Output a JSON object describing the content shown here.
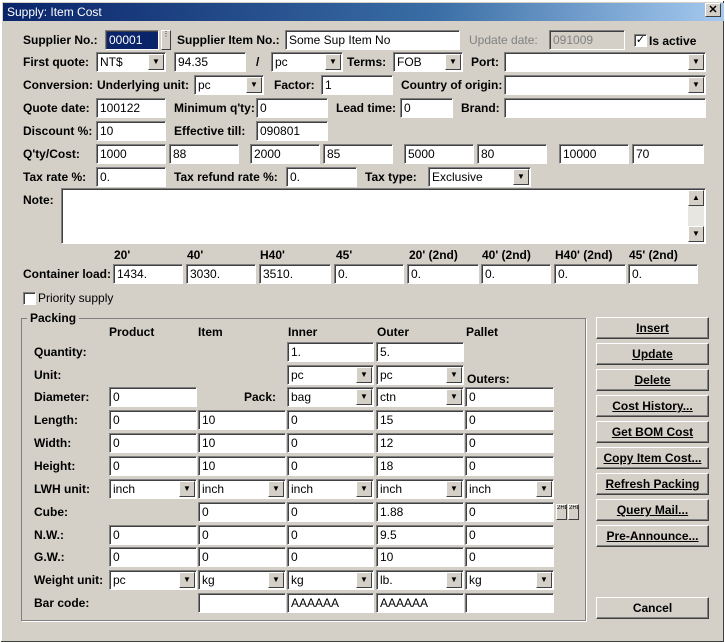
{
  "window": {
    "title": "Supply: Item Cost",
    "close": "✕"
  },
  "labels": {
    "supplier_no": "Supplier No.:",
    "supplier_item_no": "Supplier Item No.:",
    "update_date": "Update date:",
    "is_active": "Is active",
    "first_quote": "First quote:",
    "slash": "/",
    "terms": "Terms:",
    "port": "Port:",
    "conversion": "Conversion:",
    "underlying_unit": "Underlying unit:",
    "factor": "Factor:",
    "country_of_origin": "Country of origin:",
    "quote_date": "Quote date:",
    "minimum_qty": "Minimum q'ty:",
    "lead_time": "Lead time:",
    "brand": "Brand:",
    "discount": "Discount %:",
    "effective_till": "Effective till:",
    "qty_cost": "Q'ty/Cost:",
    "tax_rate": "Tax rate %:",
    "tax_refund_rate": "Tax refund rate %:",
    "tax_type": "Tax type:",
    "note": "Note:",
    "container_load": "Container load:",
    "priority_supply": "Priority supply"
  },
  "values": {
    "supplier_no": "00001",
    "supplier_item_no": "Some Sup Item No",
    "update_date": "091009",
    "is_active_checked": "✓",
    "currency": "NT$",
    "first_quote": "94.35",
    "quote_unit": "pc",
    "terms": "FOB",
    "port": "",
    "underlying_unit": "pc",
    "factor": "1",
    "country_of_origin": "",
    "quote_date": "100122",
    "minimum_qty": "0",
    "lead_time": "0",
    "brand": "",
    "discount": "10",
    "effective_till": "090801",
    "qty_cost": [
      "1000",
      "88",
      "2000",
      "85",
      "5000",
      "80",
      "10000",
      "70"
    ],
    "tax_rate": "0.",
    "tax_refund_rate": "0.",
    "tax_type": "Exclusive",
    "note": ""
  },
  "container": {
    "headers": [
      "20'",
      "40'",
      "H40'",
      "45'",
      "20' (2nd)",
      "40' (2nd)",
      "H40' (2nd)",
      "45' (2nd)"
    ],
    "values": [
      "1434.",
      "3030.",
      "3510.",
      "0.",
      "0.",
      "0.",
      "0.",
      "0."
    ]
  },
  "packing": {
    "title": "Packing",
    "columns": [
      "Product",
      "Item",
      "Inner",
      "Outer",
      "Pallet"
    ],
    "outers_label": "Outers:",
    "pack_label": "Pack:",
    "rows": {
      "quantity": {
        "label": "Quantity:",
        "inner": "1.",
        "outer": "5."
      },
      "unit": {
        "label": "Unit:",
        "inner": "pc",
        "outer": "pc"
      },
      "diameter": {
        "label": "Diameter:",
        "product": "0",
        "inner": "bag",
        "outer": "ctn",
        "pallet": "0"
      },
      "length": {
        "label": "Length:",
        "product": "0",
        "item": "10",
        "inner": "0",
        "outer": "15",
        "pallet": "0"
      },
      "width": {
        "label": "Width:",
        "product": "0",
        "item": "10",
        "inner": "0",
        "outer": "12",
        "pallet": "0"
      },
      "height": {
        "label": "Height:",
        "product": "0",
        "item": "10",
        "inner": "0",
        "outer": "18",
        "pallet": "0"
      },
      "lwh_unit": {
        "label": "LWH unit:",
        "product": "inch",
        "item": "inch",
        "inner": "inch",
        "outer": "inch",
        "pallet": "inch"
      },
      "cube": {
        "label": "Cube:",
        "item": "0",
        "inner": "0",
        "outer": "1.88",
        "pallet": "0"
      },
      "nw": {
        "label": "N.W.:",
        "product": "0",
        "item": "0",
        "inner": "0",
        "outer": "9.5",
        "pallet": "0"
      },
      "gw": {
        "label": "G.W.:",
        "product": "0",
        "item": "0",
        "inner": "0",
        "outer": "10",
        "pallet": "0"
      },
      "weight_unit": {
        "label": "Weight unit:",
        "product": "pc",
        "item": "kg",
        "inner": "kg",
        "outer": "lb.",
        "pallet": "kg"
      },
      "bar_code": {
        "label": "Bar code:",
        "item": "",
        "inner": "AAAAAA",
        "outer": "AAAAAA",
        "pallet": ""
      }
    }
  },
  "buttons": [
    "Insert",
    "Update",
    "Delete",
    "Cost History...",
    "Get BOM Cost",
    "Copy Item Cost...",
    "Refresh Packing",
    "Query Mail...",
    "Pre-Announce...",
    "Cancel"
  ],
  "glyphs": {
    "down": "▼",
    "up": "▲",
    "cube_btn1": "2HD",
    "cube_btn2": "2HD"
  }
}
